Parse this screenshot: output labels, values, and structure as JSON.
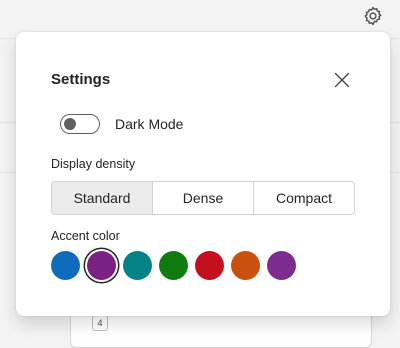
{
  "settings_dialog": {
    "title": "Settings",
    "close_icon": "close-icon",
    "dark_mode": {
      "label": "Dark Mode",
      "checked": false
    },
    "display_density": {
      "label": "Display density",
      "options": [
        "Standard",
        "Dense",
        "Compact"
      ],
      "selected": "Standard"
    },
    "accent_color": {
      "label": "Accent color",
      "colors": [
        "#0f6cbd",
        "#7a2184",
        "#038387",
        "#107c10",
        "#c50f1f",
        "#ca5010",
        "#7b2c8e"
      ],
      "selected_index": 1
    }
  },
  "background": {
    "settings_icon": "gear-icon",
    "badge_text": "4"
  }
}
